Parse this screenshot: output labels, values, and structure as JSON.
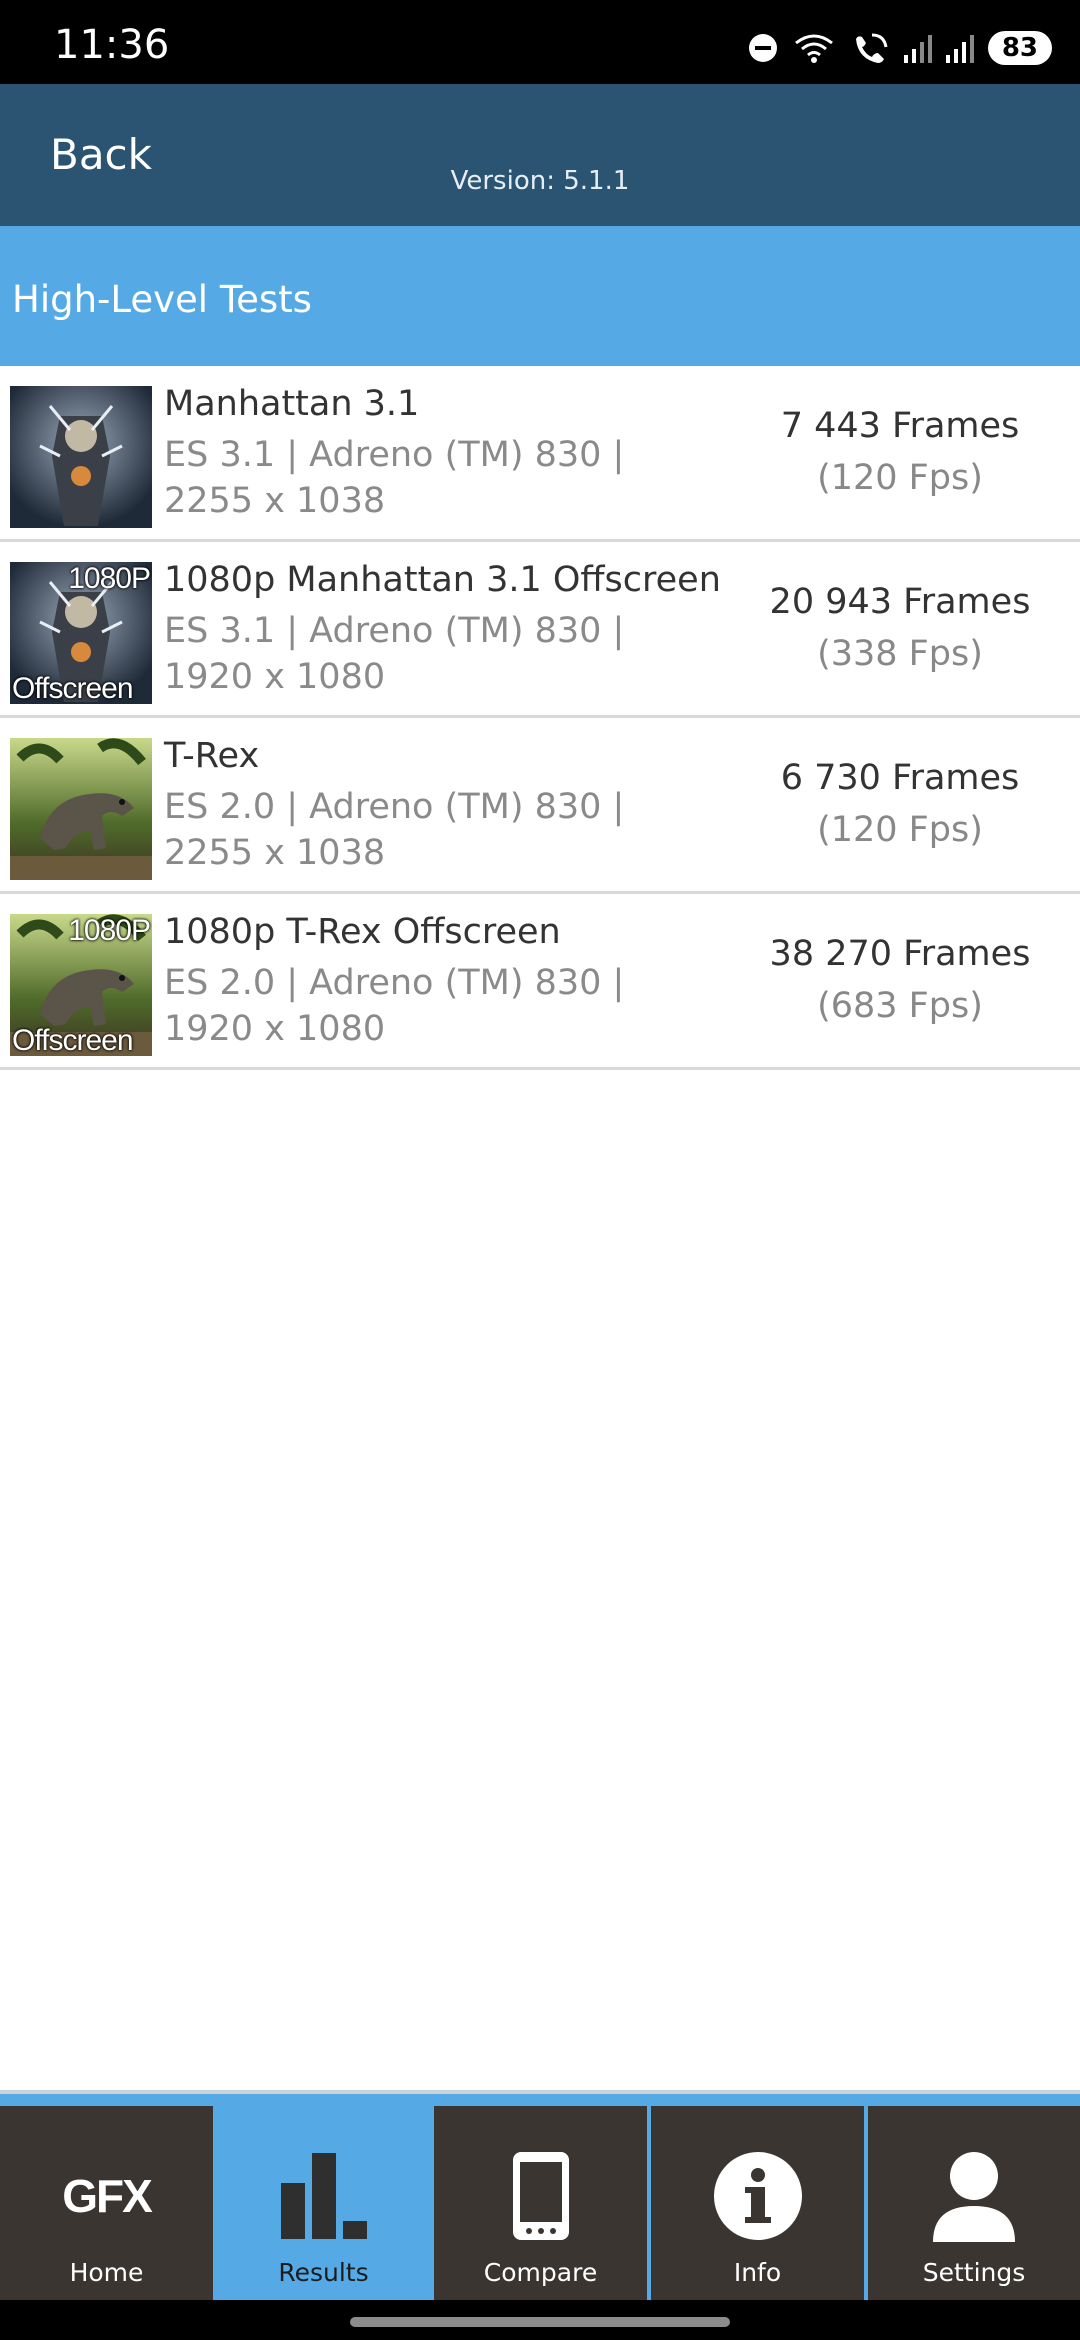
{
  "status_bar": {
    "time": "11:36",
    "battery": "83",
    "icons": [
      "dnd-icon",
      "wifi-icon",
      "wifi-call-icon",
      "signal-icon",
      "signal-icon"
    ]
  },
  "header": {
    "back_label": "Back",
    "version": "Version: 5.1.1"
  },
  "section": {
    "title": "High-Level Tests"
  },
  "results": [
    {
      "name": "Manhattan 3.1",
      "description": "ES 3.1 | Adreno (TM) 830 | 2255 x 1038",
      "score": "7 443 Frames",
      "fps": "(120 Fps)",
      "thumb_top": "",
      "thumb_bottom": "",
      "thumb_icon": "manhattan-thumbnail-icon"
    },
    {
      "name": "1080p Manhattan 3.1 Offscreen",
      "description": "ES 3.1 | Adreno (TM) 830 | 1920 x 1080",
      "score": "20 943 Frames",
      "fps": "(338 Fps)",
      "thumb_top": "1080P",
      "thumb_bottom": "Offscreen",
      "thumb_icon": "manhattan-offscreen-thumbnail-icon"
    },
    {
      "name": "T-Rex",
      "description": "ES 2.0 | Adreno (TM) 830 | 2255 x 1038",
      "score": "6 730 Frames",
      "fps": "(120 Fps)",
      "thumb_top": "",
      "thumb_bottom": "",
      "thumb_icon": "trex-thumbnail-icon"
    },
    {
      "name": "1080p T-Rex Offscreen",
      "description": "ES 2.0 | Adreno (TM) 830 | 1920 x 1080",
      "score": "38 270 Frames",
      "fps": "(683 Fps)",
      "thumb_top": "1080P",
      "thumb_bottom": "Offscreen",
      "thumb_icon": "trex-offscreen-thumbnail-icon"
    }
  ],
  "nav": {
    "items": [
      {
        "label": "Home",
        "icon": "gfx-logo-icon",
        "logo_text": "GFX",
        "active": false
      },
      {
        "label": "Results",
        "icon": "bar-chart-icon",
        "active": true
      },
      {
        "label": "Compare",
        "icon": "phone-icon",
        "active": false
      },
      {
        "label": "Info",
        "icon": "info-icon",
        "active": false
      },
      {
        "label": "Settings",
        "icon": "user-icon",
        "active": false
      }
    ]
  },
  "colors": {
    "header_bg": "#2a5472",
    "accent": "#55aae6",
    "nav_bg": "#3a3531"
  }
}
